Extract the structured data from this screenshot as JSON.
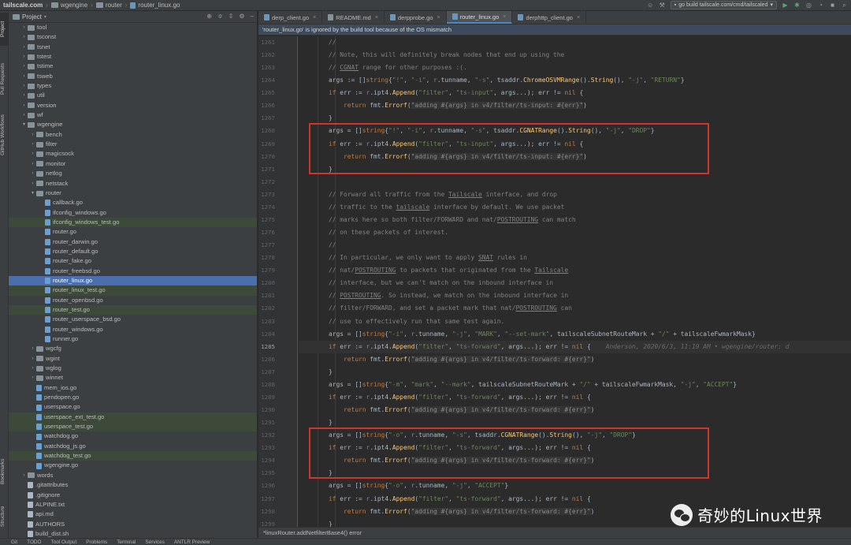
{
  "titlebar": {
    "crumbs": [
      "tailscale.com",
      "wgengine",
      "router",
      "router_linux.go"
    ],
    "run_config": "go build tailscale.com/cmd/tailscaled"
  },
  "left_tabs": [
    "Project",
    "Pull Requests",
    "GitHub Workflows",
    "Bookmarks",
    "Structure"
  ],
  "project": {
    "title": "Project",
    "tree": [
      {
        "label": "tool",
        "kind": "dir",
        "depth": 1,
        "arrow": "closed"
      },
      {
        "label": "tsconst",
        "kind": "dir",
        "depth": 1,
        "arrow": "closed"
      },
      {
        "label": "tsnet",
        "kind": "dir",
        "depth": 1,
        "arrow": "closed"
      },
      {
        "label": "tstest",
        "kind": "dir",
        "depth": 1,
        "arrow": "closed"
      },
      {
        "label": "tstime",
        "kind": "dir",
        "depth": 1,
        "arrow": "closed"
      },
      {
        "label": "tsweb",
        "kind": "dir",
        "depth": 1,
        "arrow": "closed"
      },
      {
        "label": "types",
        "kind": "dir",
        "depth": 1,
        "arrow": "closed"
      },
      {
        "label": "util",
        "kind": "dir",
        "depth": 1,
        "arrow": "closed"
      },
      {
        "label": "version",
        "kind": "dir",
        "depth": 1,
        "arrow": "closed"
      },
      {
        "label": "wf",
        "kind": "dir",
        "depth": 1,
        "arrow": "closed"
      },
      {
        "label": "wgengine",
        "kind": "dir",
        "depth": 1,
        "arrow": "open"
      },
      {
        "label": "bench",
        "kind": "dir",
        "depth": 2,
        "arrow": "closed"
      },
      {
        "label": "filter",
        "kind": "dir",
        "depth": 2,
        "arrow": "closed"
      },
      {
        "label": "magicsock",
        "kind": "dir",
        "depth": 2,
        "arrow": "closed"
      },
      {
        "label": "monitor",
        "kind": "dir",
        "depth": 2,
        "arrow": "closed"
      },
      {
        "label": "netlog",
        "kind": "dir",
        "depth": 2,
        "arrow": "closed"
      },
      {
        "label": "netstack",
        "kind": "dir",
        "depth": 2,
        "arrow": "closed"
      },
      {
        "label": "router",
        "kind": "dir",
        "depth": 2,
        "arrow": "open"
      },
      {
        "label": "callback.go",
        "kind": "file",
        "depth": 3
      },
      {
        "label": "ifconfig_windows.go",
        "kind": "file",
        "depth": 3
      },
      {
        "label": "ifconfig_windows_test.go",
        "kind": "file",
        "depth": 3,
        "state": "ignored"
      },
      {
        "label": "router.go",
        "kind": "file",
        "depth": 3
      },
      {
        "label": "router_darwin.go",
        "kind": "file",
        "depth": 3
      },
      {
        "label": "router_default.go",
        "kind": "file",
        "depth": 3
      },
      {
        "label": "router_fake.go",
        "kind": "file",
        "depth": 3
      },
      {
        "label": "router_freebsd.go",
        "kind": "file",
        "depth": 3
      },
      {
        "label": "router_linux.go",
        "kind": "file",
        "depth": 3,
        "state": "selected"
      },
      {
        "label": "router_linux_test.go",
        "kind": "file",
        "depth": 3,
        "state": "ignored"
      },
      {
        "label": "router_openbsd.go",
        "kind": "file",
        "depth": 3
      },
      {
        "label": "router_test.go",
        "kind": "file",
        "depth": 3,
        "state": "ignored"
      },
      {
        "label": "router_userspace_bsd.go",
        "kind": "file",
        "depth": 3
      },
      {
        "label": "router_windows.go",
        "kind": "file",
        "depth": 3
      },
      {
        "label": "runner.go",
        "kind": "file",
        "depth": 3
      },
      {
        "label": "wgcfg",
        "kind": "dir",
        "depth": 2,
        "arrow": "closed"
      },
      {
        "label": "wgint",
        "kind": "dir",
        "depth": 2,
        "arrow": "closed"
      },
      {
        "label": "wglog",
        "kind": "dir",
        "depth": 2,
        "arrow": "closed"
      },
      {
        "label": "winnet",
        "kind": "dir",
        "depth": 2,
        "arrow": "closed"
      },
      {
        "label": "mem_ios.go",
        "kind": "file",
        "depth": 2
      },
      {
        "label": "pendopen.go",
        "kind": "file",
        "depth": 2
      },
      {
        "label": "userspace.go",
        "kind": "file",
        "depth": 2
      },
      {
        "label": "userspace_ext_test.go",
        "kind": "file",
        "depth": 2,
        "state": "ignored"
      },
      {
        "label": "userspace_test.go",
        "kind": "file",
        "depth": 2,
        "state": "ignored"
      },
      {
        "label": "watchdog.go",
        "kind": "file",
        "depth": 2
      },
      {
        "label": "watchdog_js.go",
        "kind": "file",
        "depth": 2
      },
      {
        "label": "watchdog_test.go",
        "kind": "file",
        "depth": 2,
        "state": "ignored"
      },
      {
        "label": "wgengine.go",
        "kind": "file",
        "depth": 2
      },
      {
        "label": "words",
        "kind": "dir",
        "depth": 1,
        "arrow": "closed"
      },
      {
        "label": ".gitattributes",
        "kind": "text",
        "depth": 1
      },
      {
        "label": ".gitignore",
        "kind": "text",
        "depth": 1
      },
      {
        "label": "ALPINE.txt",
        "kind": "text",
        "depth": 1
      },
      {
        "label": "api.md",
        "kind": "text",
        "depth": 1
      },
      {
        "label": "AUTHORS",
        "kind": "text",
        "depth": 1
      },
      {
        "label": "build_dist.sh",
        "kind": "text",
        "depth": 1
      }
    ]
  },
  "editor": {
    "tabs": [
      {
        "label": "derp_client.go",
        "active": false
      },
      {
        "label": "README.md",
        "active": false
      },
      {
        "label": "derpprobe.go",
        "active": false
      },
      {
        "label": "router_linux.go",
        "active": true
      },
      {
        "label": "derphttp_client.go",
        "active": false
      }
    ],
    "banner": "'router_linux.go' is ignored by the build tool because of the OS mismatch",
    "current_line": 1285,
    "line_numbers": [
      1261,
      1262,
      1263,
      1264,
      1265,
      1266,
      1267,
      1268,
      1269,
      1270,
      1271,
      1272,
      1273,
      1274,
      1275,
      1276,
      1277,
      1278,
      1279,
      1280,
      1281,
      1282,
      1283,
      1284,
      1285,
      1286,
      1287,
      1288,
      1289,
      1290,
      1291,
      1292,
      1293,
      1294,
      1295,
      1296,
      1297,
      1298,
      1299
    ],
    "blame": "Anderson, 2020/6/3, 11:19 AM • wgengine/router: d",
    "breadcrumb": "*linuxRouter.addNetfilterBase4() error"
  },
  "bottom_tools": [
    "Git",
    "TODO",
    "Tool Output",
    "Problems",
    "Terminal",
    "Services",
    "ANTLR Preview"
  ],
  "watermark": "奇妙的Linux世界"
}
